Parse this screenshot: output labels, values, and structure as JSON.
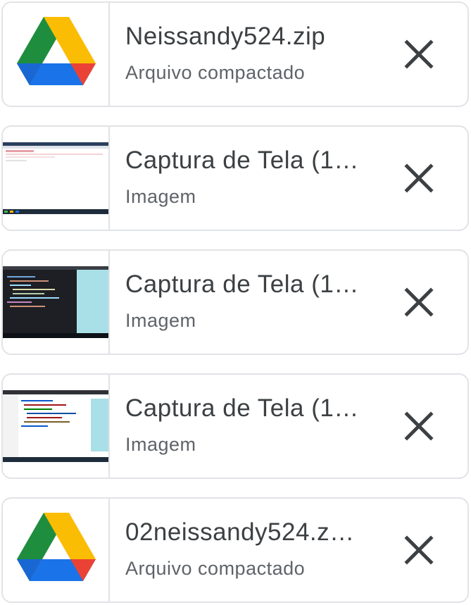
{
  "attachments": [
    {
      "name": "Neissandy524.zip",
      "type_label": "Arquivo compactado",
      "thumbnail": "google-drive-icon"
    },
    {
      "name": "Captura de Tela (1…",
      "type_label": "Imagem",
      "thumbnail": "screenshot-thumbnail"
    },
    {
      "name": "Captura de Tela (1…",
      "type_label": "Imagem",
      "thumbnail": "screenshot-thumbnail"
    },
    {
      "name": "Captura de Tela (1…",
      "type_label": "Imagem",
      "thumbnail": "screenshot-thumbnail"
    },
    {
      "name": "02neissandy524.z…",
      "type_label": "Arquivo compactado",
      "thumbnail": "google-drive-icon"
    }
  ],
  "colors": {
    "drive_green": "#1e8e3e",
    "drive_yellow": "#fbbc04",
    "drive_blue": "#1a73e8",
    "drive_red": "#ea4335",
    "close_icon": "#3c4043"
  }
}
